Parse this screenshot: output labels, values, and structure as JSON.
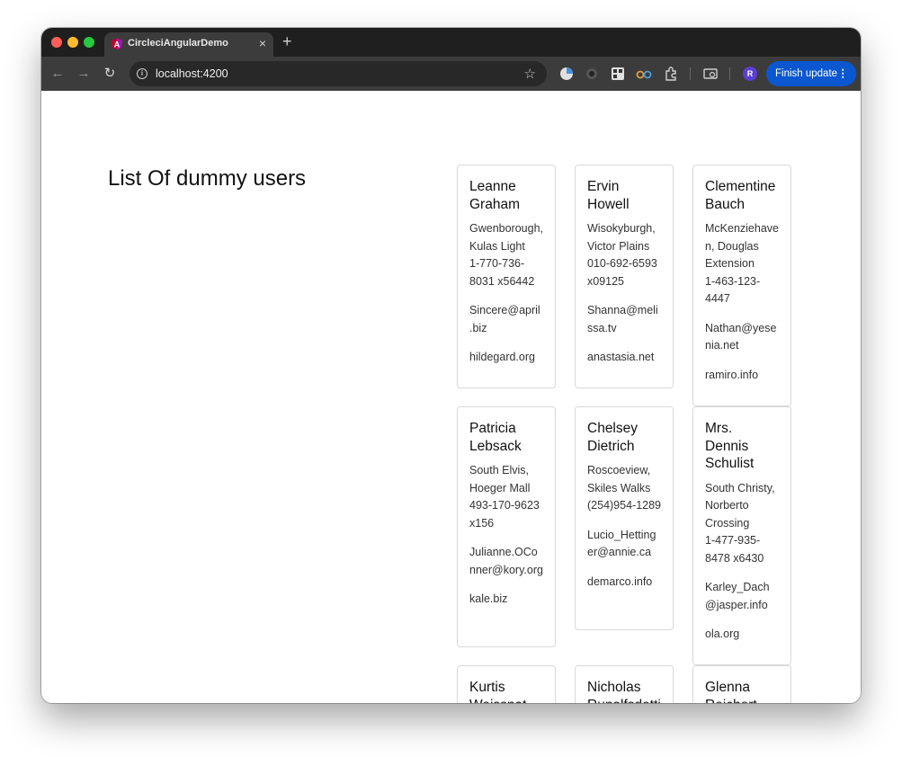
{
  "browser": {
    "tab_title": "CircleciAngularDemo",
    "tab_close": "×",
    "new_tab": "+",
    "url": "localhost:4200",
    "avatar_letter": "R",
    "finish_update_label": "Finish update",
    "finish_update_menu": "⋮",
    "accent_color": "#0b57d0"
  },
  "page": {
    "heading": "List Of dummy users"
  },
  "users": [
    {
      "name": "Leanne Graham",
      "address": "Gwenborough, Kulas Light",
      "phone": "1-770-736-8031 x56442",
      "email": "Sincere@april.biz",
      "website": "hildegard.org"
    },
    {
      "name": "Ervin Howell",
      "address": "Wisokyburgh, Victor Plains",
      "phone": "010-692-6593 x09125",
      "email": "Shanna@melissa.tv",
      "website": "anastasia.net"
    },
    {
      "name": "Clementine Bauch",
      "address": "McKenziehaven, Douglas Extension",
      "phone": "1-463-123-4447",
      "email": "Nathan@yesenia.net",
      "website": "ramiro.info"
    },
    {
      "name": "Patricia Lebsack",
      "address": "South Elvis, Hoeger Mall",
      "phone": "493-170-9623 x156",
      "email": "Julianne.OConner@kory.org",
      "website": "kale.biz"
    },
    {
      "name": "Chelsey Dietrich",
      "address": "Roscoeview, Skiles Walks",
      "phone": "(254)954-1289",
      "email": "Lucio_Hettinger@annie.ca",
      "website": "demarco.info"
    },
    {
      "name": "Mrs. Dennis Schulist",
      "address": "South Christy, Norberto Crossing",
      "phone": "1-477-935-8478 x6430",
      "email": "Karley_Dach@jasper.info",
      "website": "ola.org"
    },
    {
      "name": "Kurtis Weissnat",
      "address": "",
      "phone": "",
      "email": "",
      "website": ""
    },
    {
      "name": "Nicholas Runolfsdottir",
      "address": "",
      "phone": "",
      "email": "",
      "website": ""
    },
    {
      "name": "Glenna Reichert",
      "address": "",
      "phone": "",
      "email": "",
      "website": ""
    }
  ]
}
